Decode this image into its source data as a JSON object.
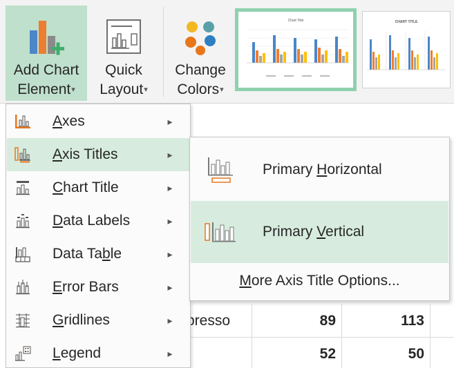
{
  "ribbon": {
    "add_chart_element": {
      "line1": "Add Chart",
      "line2": "Element",
      "caret": "▾"
    },
    "quick_layout": {
      "line1": "Quick",
      "line2": "Layout",
      "caret": "▾"
    },
    "change_colors": {
      "line1": "Change",
      "line2": "Colors",
      "caret": "▾"
    },
    "style_thumb_title_1": "Chart Title",
    "style_thumb_title_2": "CHART TITLE"
  },
  "colors": {
    "accent_green": "#bfe0cc",
    "hover_green": "#d7ecde",
    "selected_border": "#8fd1ae",
    "icon_orange": "#e8761a",
    "series_blue": "#4a86c8",
    "series_orange": "#ed7d31",
    "series_gray": "#a5a5a5",
    "series_yellow": "#ffc000",
    "dot_yellow": "#f2b824",
    "dot_orange": "#e8761a",
    "dot_blue": "#2d7fc1",
    "dot_teal": "#5aa0a8"
  },
  "menu": {
    "items": [
      {
        "label_pre": "",
        "label_u": "A",
        "label_post": "xes",
        "icon": "axes-icon",
        "arrow": "▸"
      },
      {
        "label_pre": "",
        "label_u": "A",
        "label_post": "xis Titles",
        "icon": "axis-titles-icon",
        "arrow": "▸"
      },
      {
        "label_pre": "",
        "label_u": "C",
        "label_post": "hart Title",
        "icon": "chart-title-icon",
        "arrow": "▸"
      },
      {
        "label_pre": "",
        "label_u": "D",
        "label_post": "ata Labels",
        "icon": "data-labels-icon",
        "arrow": "▸"
      },
      {
        "label_pre": "Data Ta",
        "label_u": "b",
        "label_post": "le",
        "icon": "data-table-icon",
        "arrow": "▸"
      },
      {
        "label_pre": "",
        "label_u": "E",
        "label_post": "rror Bars",
        "icon": "error-bars-icon",
        "arrow": "▸"
      },
      {
        "label_pre": "",
        "label_u": "G",
        "label_post": "ridlines",
        "icon": "gridlines-icon",
        "arrow": "▸"
      },
      {
        "label_pre": "",
        "label_u": "L",
        "label_post": "egend",
        "icon": "legend-icon",
        "arrow": "▸"
      }
    ]
  },
  "submenu": {
    "primary_horizontal": {
      "pre": "Primary ",
      "u": "H",
      "post": "orizontal"
    },
    "primary_vertical": {
      "pre": "Primary ",
      "u": "V",
      "post": "ertical"
    },
    "more_options": {
      "pre": "",
      "u": "M",
      "post": "ore Axis Title Options..."
    }
  },
  "sheet": {
    "rows": [
      {
        "name": "presso",
        "v1": "89",
        "v2": "113"
      },
      {
        "name": "",
        "v1": "52",
        "v2": "50"
      }
    ]
  }
}
